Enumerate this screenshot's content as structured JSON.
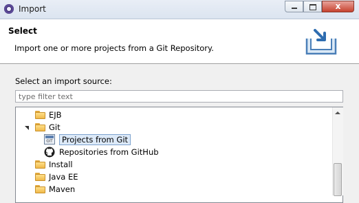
{
  "window": {
    "title": "Import",
    "controls": {
      "close_label": "x"
    }
  },
  "header": {
    "title": "Select",
    "description": "Import one or more projects from a Git Repository.",
    "icon": "import-wizard-icon"
  },
  "source": {
    "label": "Select an import source:",
    "filter_placeholder": "type filter text",
    "filter_value": ""
  },
  "tree": {
    "items": [
      {
        "label": "EJB",
        "icon": "folder-icon",
        "expanded": false
      },
      {
        "label": "Git",
        "icon": "folder-icon",
        "expanded": true
      },
      {
        "label": "Projects from Git",
        "icon": "git-icon",
        "selected": true
      },
      {
        "label": "Repositories from GitHub",
        "icon": "github-icon"
      },
      {
        "label": "Install",
        "icon": "folder-icon",
        "expanded": false
      },
      {
        "label": "Java EE",
        "icon": "folder-icon",
        "expanded": false
      },
      {
        "label": "Maven",
        "icon": "folder-icon",
        "expanded": false
      }
    ]
  },
  "colors": {
    "selection_bg": "#dce9f8",
    "selection_border": "#7da2ce",
    "folder": "#f0b94a"
  }
}
